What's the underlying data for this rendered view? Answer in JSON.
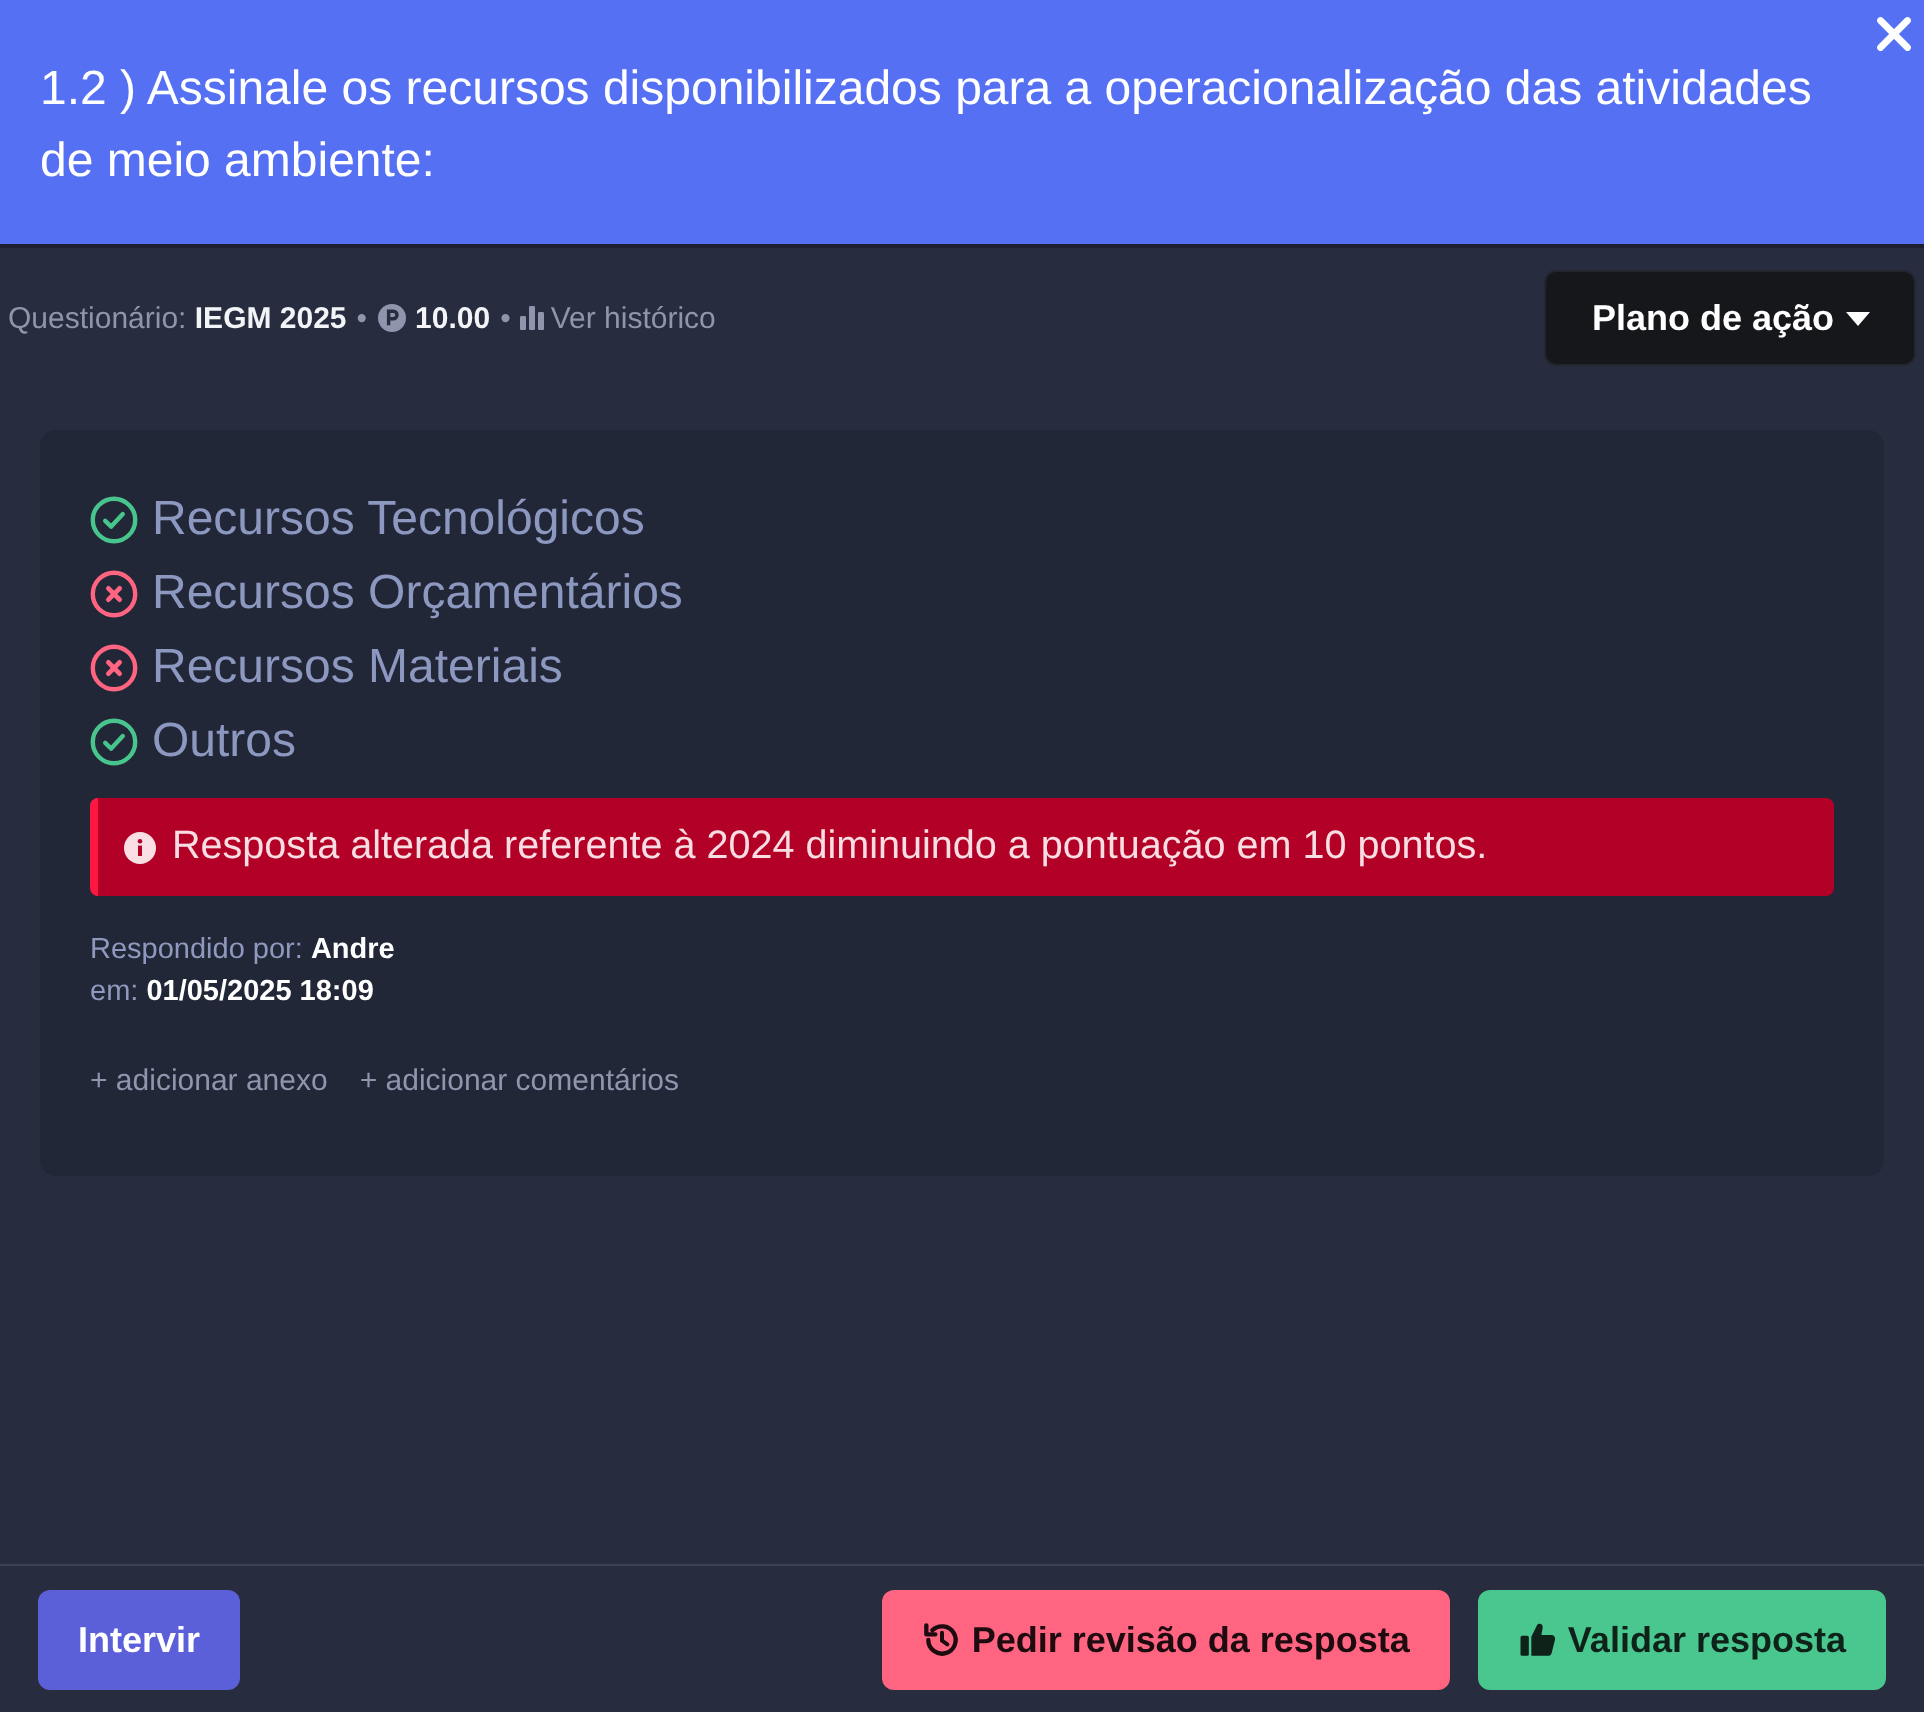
{
  "dialog": {
    "title": "1.2 ) Assinale os recursos disponibilizados para a operacionalização das atividades de meio ambiente:"
  },
  "meta": [
    {
      "kind": "text",
      "text": "Questionário: **IEGM 2025**"
    },
    {
      "kind": "separator",
      "text": "•"
    },
    {
      "kind": "points",
      "value": "10.00"
    },
    {
      "kind": "separator",
      "text": "•"
    },
    {
      "kind": "link",
      "text": "Ver histórico"
    }
  ],
  "action_menu": {
    "label": "Plano de ação"
  },
  "options": [
    {
      "label": "Recursos Tecnológicos",
      "checked": true
    },
    {
      "label": "Recursos Orçamentários",
      "checked": false
    },
    {
      "label": "Recursos Materiais",
      "checked": false
    },
    {
      "label": "Outros",
      "checked": true
    }
  ],
  "alert": {
    "kind": "danger",
    "text": "Resposta alterada referente à 2024 diminuindo a pontuação em 10 pontos."
  },
  "answered": {
    "by": "Respondido por: **Andre**",
    "at": "em: **01/05/2025 18:09**"
  },
  "links": [
    "+ adicionar anexo",
    "+ adicionar comentários"
  ],
  "footer_buttons": [
    {
      "kind": "primary",
      "label": "Intervir"
    },
    {
      "kind": "danger",
      "label": "Pedir revisão da resposta"
    },
    {
      "kind": "success",
      "label": "Validar resposta"
    }
  ]
}
